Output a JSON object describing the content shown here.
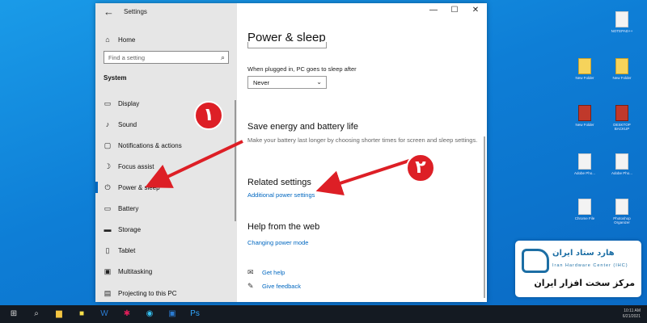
{
  "window": {
    "title": "Settings",
    "back_icon": "back-arrow-icon",
    "minimize": "—",
    "maximize": "☐",
    "close": "✕"
  },
  "sidebar": {
    "home_label": "Home",
    "search_placeholder": "Find a setting",
    "section_title": "System",
    "items": [
      {
        "label": "Display",
        "icon": "display-icon"
      },
      {
        "label": "Sound",
        "icon": "sound-icon"
      },
      {
        "label": "Notifications & actions",
        "icon": "notifications-icon"
      },
      {
        "label": "Focus assist",
        "icon": "moon-icon"
      },
      {
        "label": "Power & sleep",
        "icon": "power-icon",
        "active": true
      },
      {
        "label": "Battery",
        "icon": "battery-icon"
      },
      {
        "label": "Storage",
        "icon": "storage-icon"
      },
      {
        "label": "Tablet",
        "icon": "tablet-icon"
      },
      {
        "label": "Multitasking",
        "icon": "multitasking-icon"
      },
      {
        "label": "Projecting to this PC",
        "icon": "projecting-icon"
      }
    ]
  },
  "content": {
    "page_title": "Power & sleep",
    "prev_select_value": "Never",
    "plugged_sleep_label": "When plugged in, PC goes to sleep after",
    "plugged_sleep_value": "Never",
    "energy_title": "Save energy and battery life",
    "energy_desc": "Make your battery last longer by choosing shorter times for screen and sleep settings.",
    "related_title": "Related settings",
    "related_link": "Additional power settings",
    "help_title": "Help from the web",
    "help_link": "Changing power mode",
    "get_help": "Get help",
    "give_feedback": "Give feedback"
  },
  "annotations": {
    "badge1": "١",
    "badge2": "٢",
    "color": "#dd1f26"
  },
  "logo": {
    "fa_top": "هارد ستاد ایران",
    "en": "Iran Hardware Center (IHC)",
    "fa_bottom": "مرکز سخت افزار ایران"
  },
  "desktop_icons": [
    {
      "caption": "NOTEPAD++",
      "style": "plain"
    },
    {
      "caption": "New Folder",
      "style": "yel"
    },
    {
      "caption": "New Folder",
      "style": "yel"
    },
    {
      "caption": "New Folder",
      "style": "red"
    },
    {
      "caption": "DESKTOP BACKUP",
      "style": "red"
    },
    {
      "caption": "Adobe Pho...",
      "style": "plain"
    },
    {
      "caption": "Adobe Pho...",
      "style": "plain"
    },
    {
      "caption": "Chrome File",
      "style": "plain"
    },
    {
      "caption": "Photoshop Organizer",
      "style": "plain"
    }
  ],
  "taskbar": {
    "time": "10:11 AM",
    "date": "6/21/2021"
  }
}
